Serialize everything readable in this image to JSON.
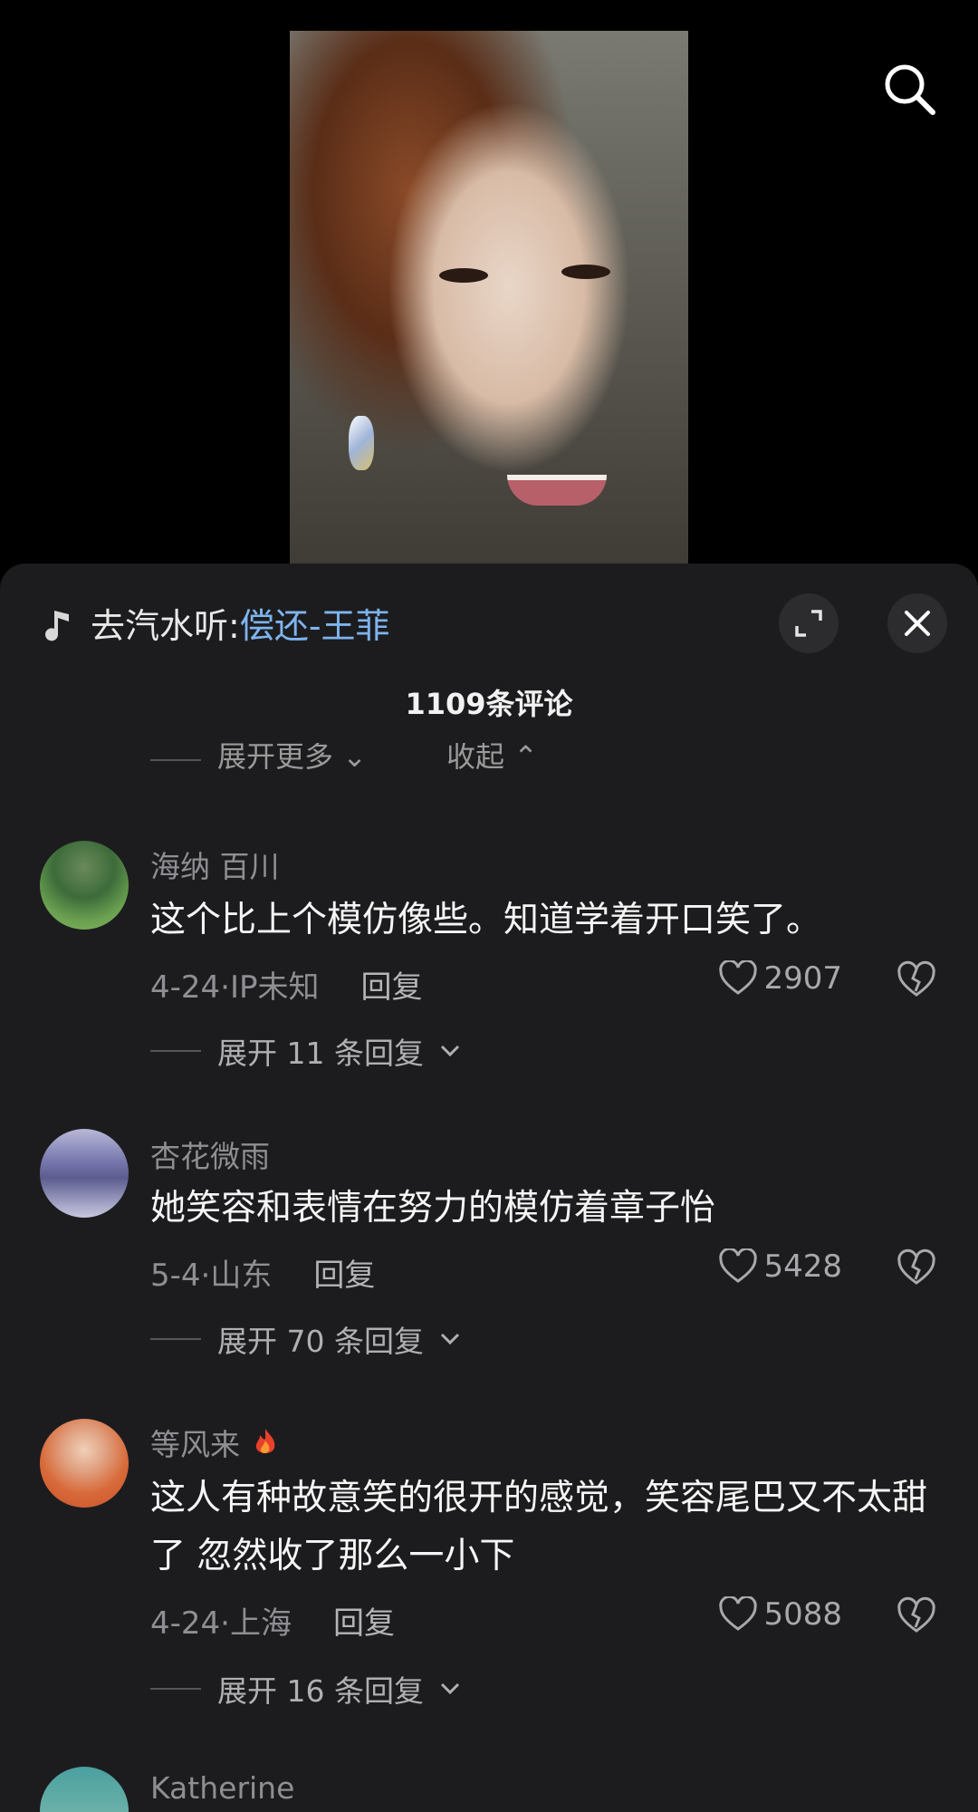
{
  "music": {
    "prefix": "去汽水听:",
    "song": "偿还-王菲"
  },
  "comment_count": "1109条评论",
  "partial_row": {
    "more": "展开更多 ⌄",
    "collapse": "收起 ⌃"
  },
  "comments": [
    {
      "user": "海纳 百川",
      "text": "这个比上个模仿像些。知道学着开口笑了。",
      "meta": "4-24·IP未知",
      "reply": "回复",
      "likes": "2907",
      "expand": "展开 11 条回复"
    },
    {
      "user": "杏花微雨",
      "text": "她笑容和表情在努力的模仿着章子怡",
      "meta": "5-4·山东",
      "reply": "回复",
      "likes": "5428",
      "expand": "展开 70 条回复"
    },
    {
      "user": "等风来",
      "text": "这人有种故意笑的很开的感觉，笑容尾巴又不太甜了 忽然收了那么一小下",
      "meta": "4-24·上海",
      "reply": "回复",
      "likes": "5088",
      "expand": "展开 16 条回复"
    },
    {
      "user": "Katherine"
    }
  ],
  "icons": {
    "search": "search-icon",
    "music": "music-note-icon",
    "expand_view": "expand-icon",
    "close": "close-icon",
    "like": "heart-icon",
    "dislike": "broken-heart-icon",
    "chevron": "chevron-down-icon"
  },
  "colors": {
    "panel_bg": "#1c1c1e",
    "song_link": "#7eb4ee",
    "muted_text": "#8e8e93"
  }
}
